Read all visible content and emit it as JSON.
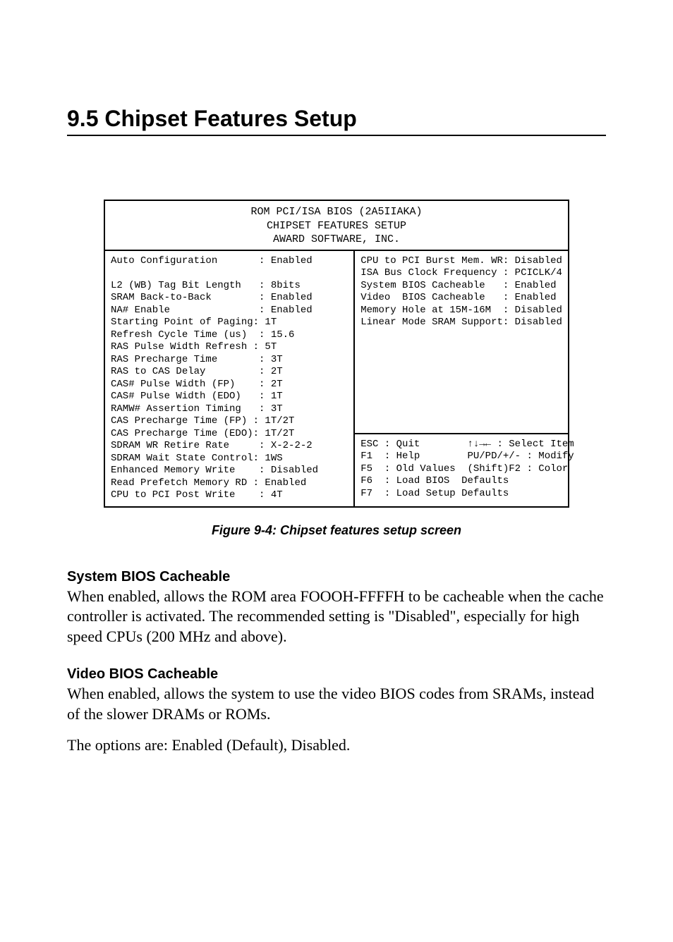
{
  "section": {
    "title": "9.5  Chipset Features Setup"
  },
  "bios": {
    "header_line1": "ROM PCI/ISA BIOS (2A5IIAKA)",
    "header_line2": "CHIPSET FEATURES SETUP",
    "header_line3": "AWARD SOFTWARE, INC.",
    "left_block": "Auto Configuration       : Enabled\n\nL2 (WB) Tag Bit Length   : 8bits\nSRAM Back-to-Back        : Enabled\nNA# Enable               : Enabled\nStarting Point of Paging: 1T\nRefresh Cycle Time (us)  : 15.6\nRAS Pulse Width Refresh : 5T\nRAS Precharge Time       : 3T\nRAS to CAS Delay         : 2T\nCAS# Pulse Width (FP)    : 2T\nCAS# Pulse Width (EDO)   : 1T\nRAMW# Assertion Timing   : 3T\nCAS Precharge Time (FP) : 1T/2T\nCAS Precharge Time (EDO): 1T/2T\nSDRAM WR Retire Rate     : X-2-2-2\nSDRAM Wait State Control: 1WS\nEnhanced Memory Write    : Disabled\nRead Prefetch Memory RD : Enabled\nCPU to PCI Post Write    : 4T",
    "right_top_block": "CPU to PCI Burst Mem. WR: Disabled\nISA Bus Clock Frequency : PCICLK/4\nSystem BIOS Cacheable   : Enabled\nVideo  BIOS Cacheable   : Enabled\nMemory Hole at 15M-16M  : Disabled\nLinear Mode SRAM Support: Disabled",
    "right_bottom_block": "ESC : Quit        ↑↓→← : Select Item\nF1  : Help        PU/PD/+/- : Modify\nF5  : Old Values  (Shift)F2 : Color\nF6  : Load BIOS  Defaults\nF7  : Load Setup Defaults"
  },
  "figure_caption": "Figure 9-4: Chipset features setup screen",
  "sub1": {
    "heading": "System BIOS Cacheable",
    "text": "When enabled, allows the ROM area FOOOH-FFFFH to be cacheable when the cache controller is activated. The recommended setting is \"Disabled\", especially for high speed CPUs (200 MHz and above)."
  },
  "sub2": {
    "heading": "Video BIOS Cacheable",
    "text1": "When enabled, allows the system to use the video BIOS codes from SRAMs, instead of the slower DRAMs or ROMs.",
    "text2": "The options are: Enabled (Default), Disabled."
  }
}
